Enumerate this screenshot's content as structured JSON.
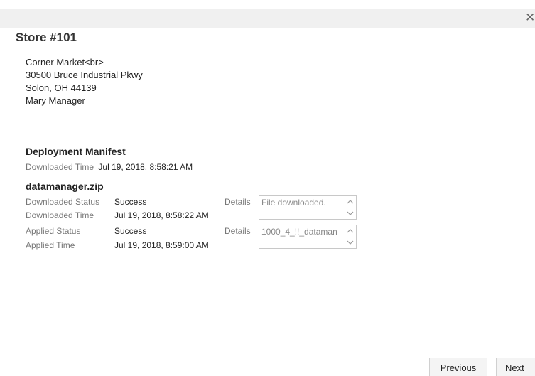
{
  "dialog": {
    "close_glyph": "✕"
  },
  "store": {
    "title": "Store #101",
    "address_lines": [
      "Corner Market<br>",
      "30500 Bruce Industrial Pkwy",
      "Solon, OH 44139",
      "Mary Manager"
    ]
  },
  "manifest": {
    "heading": "Deployment Manifest",
    "downloaded_time_label": "Downloaded Time",
    "downloaded_time_value": "Jul 19, 2018, 8:58:21 AM"
  },
  "file": {
    "name": "datamanager.zip",
    "downloaded_status_label": "Downloaded Status",
    "downloaded_status_value": "Success",
    "downloaded_time_label": "Downloaded Time",
    "downloaded_time_value": "Jul 19, 2018, 8:58:22 AM",
    "applied_status_label": "Applied Status",
    "applied_status_value": "Success",
    "applied_time_label": "Applied Time",
    "applied_time_value": "Jul 19, 2018, 8:59:00 AM",
    "details_label": "Details",
    "download_details": "File downloaded.",
    "applied_details": "1000_4_!!_dataman"
  },
  "buttons": {
    "previous": "Previous",
    "next": "Next"
  }
}
